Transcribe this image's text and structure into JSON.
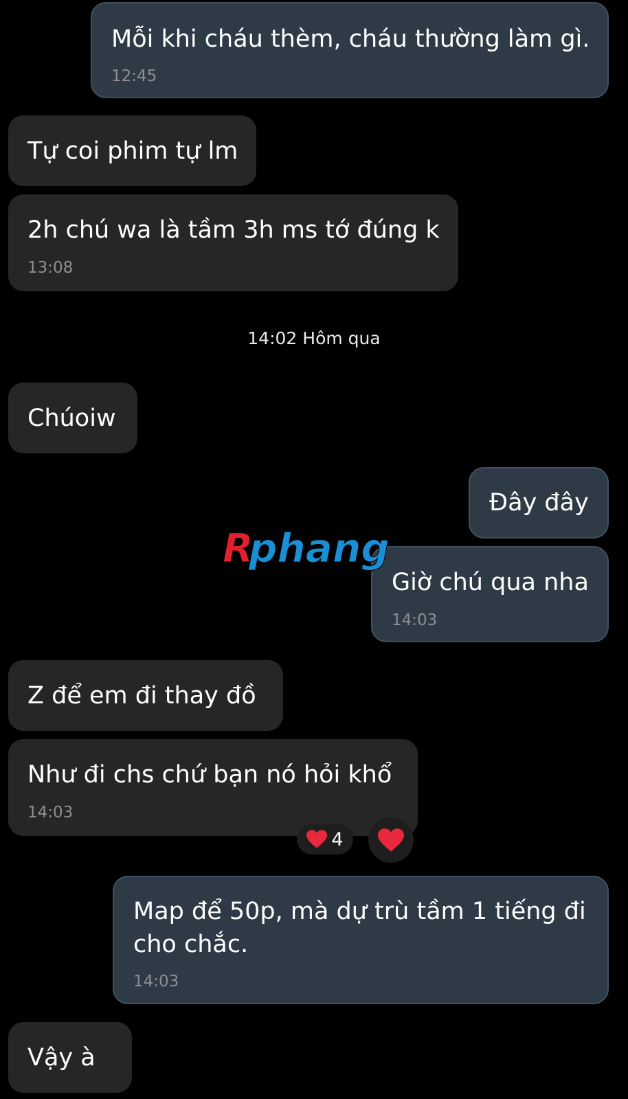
{
  "messages": [
    {
      "text": "Mỗi khi cháu thèm, cháu thường làm gì.",
      "time": "12:45"
    },
    {
      "text": "Tự coi phim tự lm"
    },
    {
      "text": "2h chú wa là tầm 3h ms tớ đúng k",
      "time": "13:08"
    },
    {
      "text": "Chúoiw"
    },
    {
      "text": "Đây đây"
    },
    {
      "text": "Giờ chú qua nha",
      "time": "14:03"
    },
    {
      "text": "Z để em đi thay đồ"
    },
    {
      "text": "Như đi chs chứ bạn nó hỏi khổ",
      "time": "14:03"
    },
    {
      "text": "Map để 50p, mà dự trù tầm 1 tiếng đi\ncho chắc.",
      "time": "14:03"
    },
    {
      "text": "Vậy à"
    }
  ],
  "divider": "14:02 Hôm qua",
  "reaction": {
    "icon": "heart-icon",
    "count": "4"
  },
  "my_reaction": {
    "icon": "heart-icon"
  },
  "watermark": "Rphang",
  "colors": {
    "background": "#000000",
    "incoming_bubble": "#262626",
    "outgoing_bubble": "#2e3b47",
    "heart": "#e8283c"
  }
}
